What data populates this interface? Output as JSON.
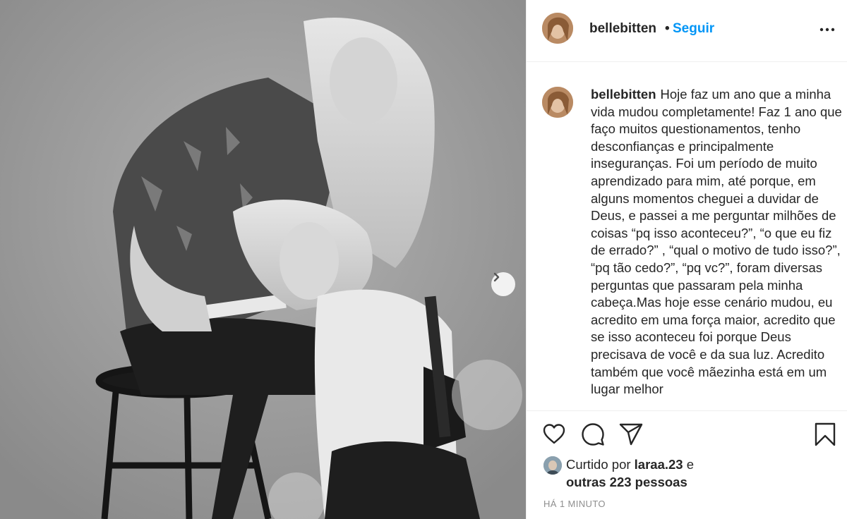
{
  "post": {
    "image_alt": "Foto em preto e branco de duas mulheres posando em um banquinho"
  },
  "header": {
    "username": "bellebitten",
    "separator": "•",
    "follow_label": "Seguir",
    "more_icon": "more-options-icon"
  },
  "caption": {
    "username": "bellebitten",
    "text": "Hoje faz um ano que a minha vida mudou completamente! Faz 1 ano que faço muitos questionamentos, tenho desconfianças e principalmente inseguranças. Foi um período de muito aprendizado para mim, até porque, em alguns momentos cheguei a duvidar de Deus, e passei a me perguntar milhões de coisas “pq isso aconteceu?”, “o que eu fiz de errado?” , “qual o motivo de tudo isso?”, “pq tão cedo?”, “pq vc?”, foram diversas perguntas que passaram pela minha cabeça.Mas hoje esse cenário mudou, eu acredito em uma força maior, acredito que se isso aconteceu foi porque Deus precisava de você e da sua luz. Acredito também que você mãezinha está em um lugar melhor"
  },
  "actions": {
    "icons": [
      "heart-icon",
      "comment-icon",
      "share-icon",
      "bookmark-icon"
    ]
  },
  "likes": {
    "prefix": "Curtido por",
    "user": "laraa.23",
    "conj": "e",
    "others": "outras 223 pessoas"
  },
  "timestamp": "HÁ 1 MINUTO",
  "colors": {
    "link_blue": "#0095f6",
    "text": "#262626",
    "muted": "#8e8e8e",
    "divider": "#efefef"
  }
}
